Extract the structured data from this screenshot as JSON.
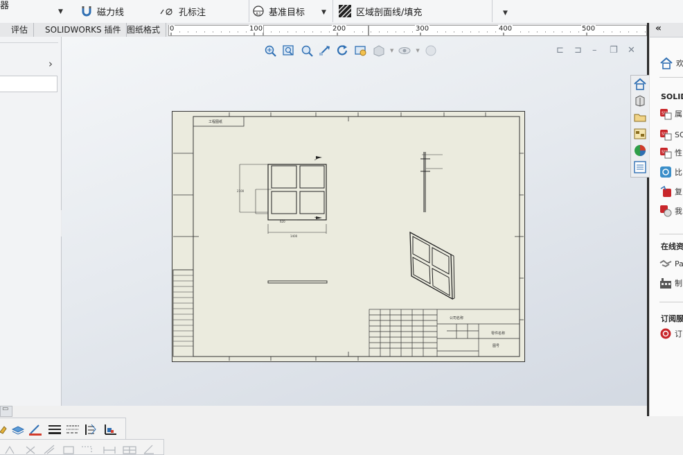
{
  "ribbon": {
    "partial_left_label": "器",
    "magnetic_line": "磁力线",
    "hole_callout": "孔标注",
    "datum_target": "基准目标",
    "area_hatch": "区域剖面线/填充"
  },
  "tabs": [
    "评估",
    "SOLIDWORKS 插件",
    "图纸格式"
  ],
  "ruler": {
    "ticks": [
      "0",
      "100",
      "200",
      "300",
      "400",
      "500"
    ]
  },
  "task_pane": {
    "welcome": "欢",
    "section1": "SOLIDV",
    "items1": [
      "属",
      "SO",
      "性",
      "比",
      "复",
      "我"
    ],
    "section2": "在线资",
    "items2": [
      "Pa",
      "制"
    ],
    "section3": "订阅服",
    "items3": [
      "订"
    ]
  },
  "drawing": {
    "title_text_main": "工程图纸",
    "title_text_a": "零件名称",
    "title_text_b": "图号"
  },
  "colors": {
    "sheet_bg": "#ebebde",
    "accent_blue": "#2f6fb3",
    "red_icon": "#c8262a"
  }
}
